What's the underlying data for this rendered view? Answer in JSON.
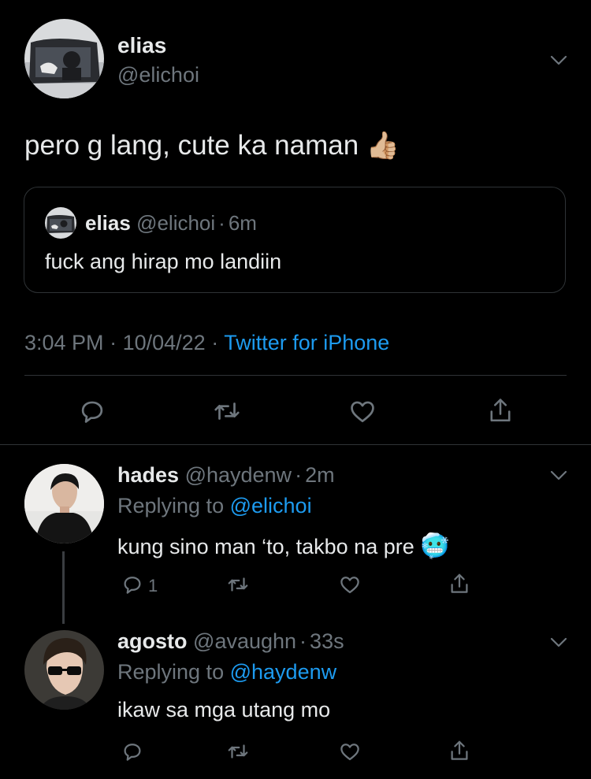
{
  "main_tweet": {
    "display_name": "elias",
    "handle": "@elichoi",
    "text": "pero g lang, cute ka naman",
    "emoji": "👍🏼",
    "quote": {
      "display_name": "elias",
      "handle": "@elichoi",
      "sep": "·",
      "time": "6m",
      "text": "fuck ang hirap mo landiin"
    },
    "meta": {
      "time": "3:04 PM",
      "sep1": "·",
      "date": "10/04/22",
      "sep2": "·",
      "source": "Twitter for iPhone"
    },
    "actions": [
      "reply-icon",
      "retweet-icon",
      "like-icon",
      "share-icon"
    ]
  },
  "replies": [
    {
      "display_name": "hades",
      "handle": "@haydenw",
      "sep": "·",
      "time": "2m",
      "replying_prefix": "Replying to",
      "replying_to": "@elichoi",
      "text": "kung sino man ‘to, takbo na pre",
      "emoji": "🥶",
      "reply_count": "1"
    },
    {
      "display_name": "agosto",
      "handle": "@avaughn",
      "sep": "·",
      "time": "33s",
      "replying_prefix": "Replying to",
      "replying_to": "@haydenw",
      "text": "ikaw sa mga utang mo",
      "reply_count": ""
    }
  ],
  "colors": {
    "background": "#000000",
    "text": "#e7e9ea",
    "muted": "#6e767d",
    "accent": "#1d9bf0",
    "divider": "#2f3336"
  }
}
